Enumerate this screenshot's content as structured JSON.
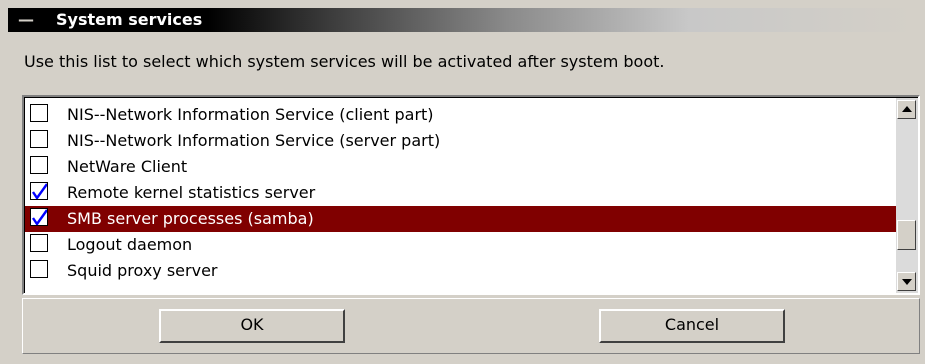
{
  "window": {
    "title": "System services",
    "collapse_glyph": "—"
  },
  "description": "Use this list to select which system services will be activated after system boot.",
  "services": [
    {
      "label": "NIS--Network Information Service (client part)",
      "checked": false,
      "selected": false
    },
    {
      "label": "NIS--Network Information Service (server part)",
      "checked": false,
      "selected": false
    },
    {
      "label": "NetWare Client",
      "checked": false,
      "selected": false
    },
    {
      "label": "Remote kernel statistics server",
      "checked": true,
      "selected": false
    },
    {
      "label": "SMB server processes (samba)",
      "checked": true,
      "selected": true
    },
    {
      "label": "Logout daemon",
      "checked": false,
      "selected": false
    },
    {
      "label": "Squid proxy server",
      "checked": false,
      "selected": false
    }
  ],
  "buttons": {
    "ok_label": "OK",
    "cancel_label": "Cancel"
  },
  "colors": {
    "selection_bg": "#800000",
    "checkmark": "#0000ff",
    "window_bg": "#d4d0c8"
  },
  "icons": {
    "checkmark": "checkmark-icon",
    "scroll_up": "arrow-up-icon",
    "scroll_down": "arrow-down-icon"
  }
}
